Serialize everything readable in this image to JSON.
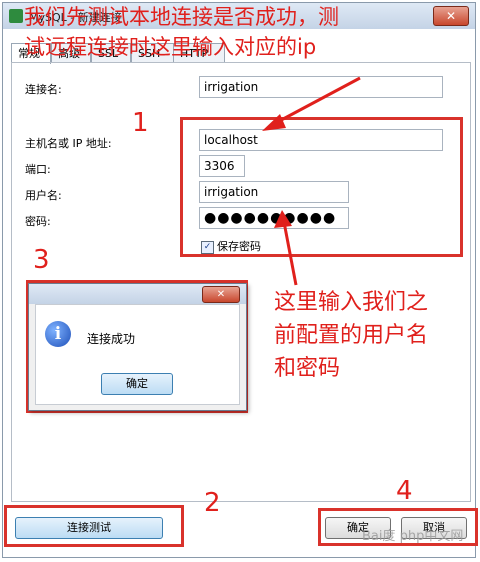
{
  "window": {
    "title": "MySQL - 新建连接",
    "close": "✕"
  },
  "tabs": [
    "常规",
    "高级",
    "SSL",
    "SSH",
    "HTTP"
  ],
  "form": {
    "connection_name_label": "连接名:",
    "connection_name_value": "irrigation",
    "host_label": "主机名或 IP 地址:",
    "host_value": "localhost",
    "port_label": "端口:",
    "port_value": "3306",
    "user_label": "用户名:",
    "user_value": "irrigation",
    "password_label": "密码:",
    "password_value": "●●●●●●●●●●",
    "save_password_label": "保存密码",
    "save_password_checked": true
  },
  "buttons": {
    "test": "连接测试",
    "ok": "确定",
    "cancel": "取消"
  },
  "dialog": {
    "message": "连接成功",
    "ok": "确定",
    "close": "✕"
  },
  "annotations": {
    "top_text": "我们先测试本地连接是否成功，测试远程连接时这里输入对应的ip",
    "top_line1": "我们先测试本地连接是否成功，测",
    "top_line2": "试远程连接时这里输入对应的ip",
    "right_line1": "这里输入我们之",
    "right_line2": "前配置的用户名",
    "right_line3": "和密码",
    "num1": "1",
    "num2": "2",
    "num3": "3",
    "num4": "4"
  },
  "watermark": "Bai度 php中文网",
  "colors": {
    "annotation_red": "#e0201c"
  }
}
